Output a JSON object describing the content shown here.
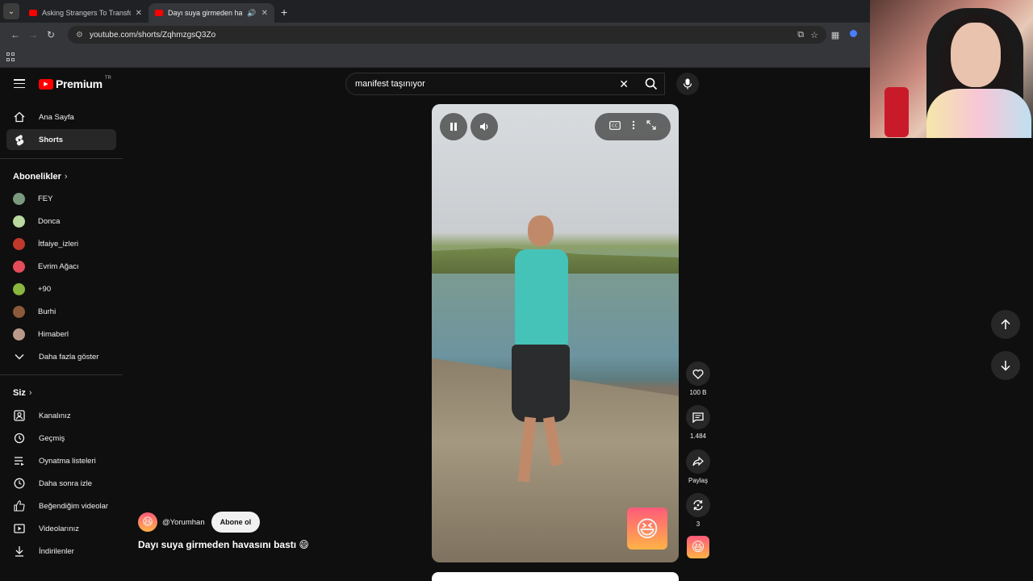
{
  "browser": {
    "tabs": [
      {
        "title": "Asking Strangers To Transform",
        "active": false
      },
      {
        "title": "Dayı suya girmeden havası",
        "active": true
      }
    ],
    "url": "youtube.com/shorts/ZqhmzgsQ3Zo"
  },
  "header": {
    "logo_text": "Premium",
    "logo_superscript": "TR",
    "search_value": "manifest taşınıyor"
  },
  "sidebar": {
    "main_items": [
      {
        "label": "Ana Sayfa",
        "icon": "home-icon"
      },
      {
        "label": "Shorts",
        "icon": "shorts-icon",
        "active": true
      }
    ],
    "subscriptions_title": "Abonelikler",
    "subscriptions": [
      {
        "label": "FEY",
        "color": "#7a9a7e"
      },
      {
        "label": "Donca",
        "color": "#b9d9a0"
      },
      {
        "label": "İtfaiye_izleri",
        "color": "#c0392b"
      },
      {
        "label": "Evrim Ağacı",
        "color": "#e44c5a"
      },
      {
        "label": "+90",
        "color": "#8ab640"
      },
      {
        "label": "Burhi",
        "color": "#8a5a3a"
      },
      {
        "label": "Himaberl",
        "color": "#b99a8a"
      }
    ],
    "show_more": "Daha fazla göster",
    "you_title": "Siz",
    "you_items": [
      {
        "label": "Kanalınız",
        "icon": "channel-icon"
      },
      {
        "label": "Geçmiş",
        "icon": "history-icon"
      },
      {
        "label": "Oynatma listeleri",
        "icon": "playlist-icon"
      },
      {
        "label": "Daha sonra izle",
        "icon": "clock-icon"
      },
      {
        "label": "Beğendiğim videolar",
        "icon": "thumbs-up-icon"
      },
      {
        "label": "Videolarınız",
        "icon": "video-icon"
      },
      {
        "label": "İndirilenler",
        "icon": "download-icon"
      }
    ]
  },
  "video": {
    "channel_handle": "@Yorumhan",
    "subscribe_label": "Abone ol",
    "title": "Dayı suya girmeden havasını bastı 😄",
    "channel_emoji": "😆"
  },
  "actions": {
    "like_count": "100 B",
    "comment_count": "1.484",
    "share_label": "Paylaş",
    "remix_count": "3"
  }
}
